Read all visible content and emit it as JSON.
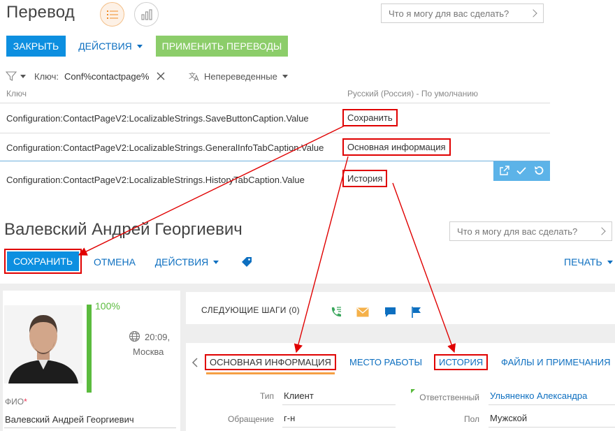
{
  "translation": {
    "title": "Перевод",
    "search_placeholder": "Что я могу для вас сделать?",
    "buttons": {
      "close": "ЗАКРЫТЬ",
      "actions": "ДЕЙСТВИЯ",
      "apply": "ПРИМЕНИТЬ ПЕРЕВОДЫ"
    },
    "filter": {
      "key_label": "Ключ:",
      "key_value": "Conf%contactpage%",
      "status": "Непереведенные"
    },
    "columns": {
      "key": "Ключ",
      "value": "Русский (Россия) - По умолчанию"
    },
    "rows": [
      {
        "key": "Configuration:ContactPageV2:LocalizableStrings.SaveButtonCaption.Value",
        "value": "Сохранить"
      },
      {
        "key": "Configuration:ContactPageV2:LocalizableStrings.GeneralInfoTabCaption.Value",
        "value": "Основная информация"
      },
      {
        "key": "Configuration:ContactPageV2:LocalizableStrings.HistoryTabCaption.Value",
        "value": "История"
      }
    ],
    "colors": {
      "accent": "#0d8fe0",
      "apply": "#8ccd6a",
      "highlight": "#e00000"
    }
  },
  "contact": {
    "name": "Валевский Андрей Георгиевич",
    "search_placeholder": "Что я могу для вас сделать?",
    "toolbar": {
      "save": "СОХРАНИТЬ",
      "cancel": "ОТМЕНА",
      "actions": "ДЕЙСТВИЯ",
      "print": "ПЕЧАТЬ"
    },
    "profile": {
      "completeness": "100%",
      "completeness_fraction": 1.0,
      "time": "20:09,",
      "city": "Москва",
      "fio_label": "ФИО",
      "fio_required": "*",
      "fio_value": "Валевский Андрей Георгиевич"
    },
    "next_steps": "СЛЕДУЮЩИЕ ШАГИ (0)",
    "tabs": [
      {
        "label": "ОСНОВНАЯ ИНФОРМАЦИЯ"
      },
      {
        "label": "МЕСТО РАБОТЫ"
      },
      {
        "label": "ИСТОРИЯ"
      },
      {
        "label": "ФАЙЛЫ И ПРИМЕЧАНИЯ"
      }
    ],
    "fields": {
      "type_label": "Тип",
      "type_value": "Клиент",
      "appeal_label": "Обращение",
      "appeal_value": "г-н",
      "owner_label": "Ответственный",
      "owner_value": "Ульяненко Александра",
      "gender_label": "Пол",
      "gender_value": "Мужской"
    }
  }
}
